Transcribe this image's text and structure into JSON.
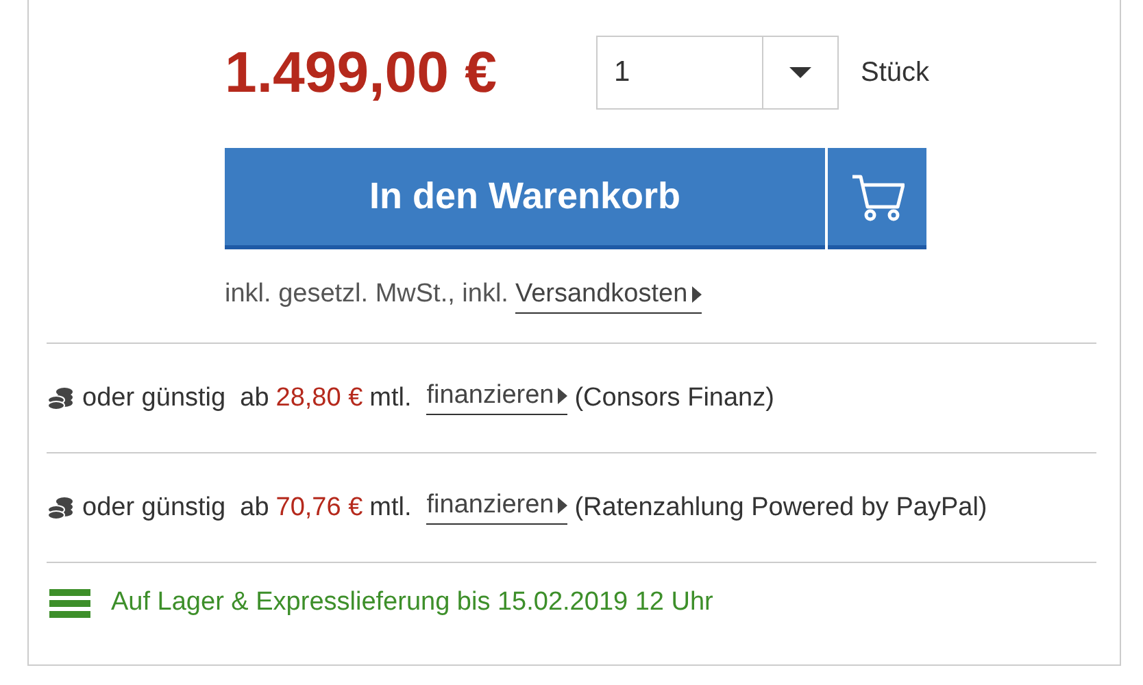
{
  "price": "1.499,00 €",
  "quantity": {
    "value": "1",
    "unit": "Stück"
  },
  "cart_button": {
    "label": "In den Warenkorb"
  },
  "tax_note": {
    "text": "inkl. gesetzl. MwSt., inkl.",
    "link": "Versandkosten"
  },
  "financing": [
    {
      "prefix": "oder günstig  ab",
      "amount": "28,80 €",
      "suffix": "mtl.",
      "link": "finanzieren",
      "provider": "(Consors Finanz)"
    },
    {
      "prefix": "oder günstig  ab",
      "amount": "70,76 €",
      "suffix": "mtl.",
      "link": "finanzieren",
      "provider": "(Ratenzahlung Powered by PayPal)"
    }
  ],
  "availability": "Auf Lager & Expresslieferung bis 15.02.2019 12 Uhr"
}
